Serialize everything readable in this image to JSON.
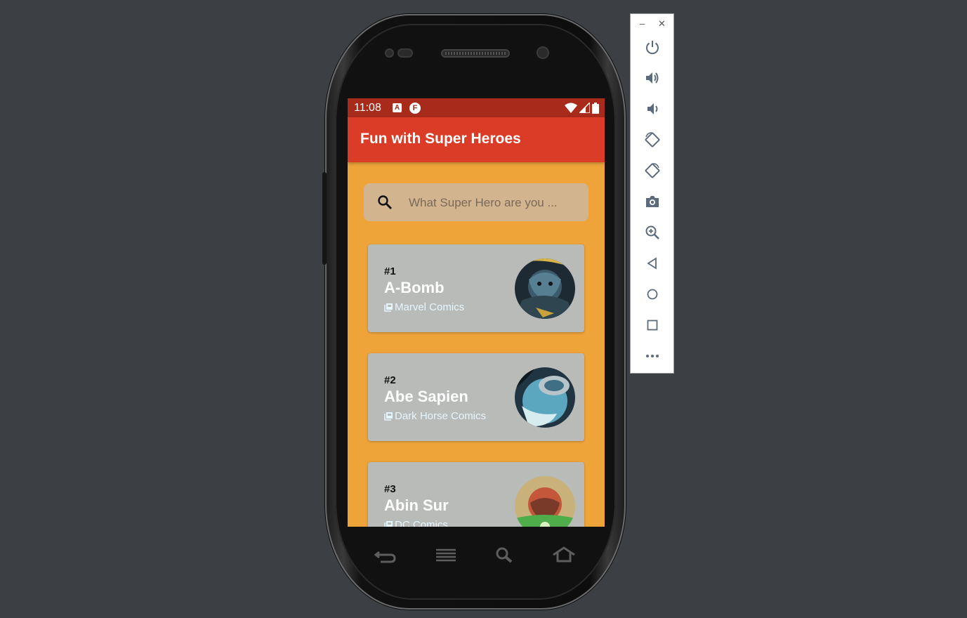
{
  "status_bar": {
    "time": "11:08",
    "icons": [
      "a-notification-icon",
      "f-notification-icon",
      "wifi-icon",
      "signal-icon",
      "battery-icon"
    ]
  },
  "app_bar": {
    "title": "Fun with Super Heroes"
  },
  "search": {
    "placeholder": "What Super Hero are you ...",
    "value": ""
  },
  "heroes": [
    {
      "rank": "#1",
      "name": "A-Bomb",
      "publisher": "Marvel Comics"
    },
    {
      "rank": "#2",
      "name": "Abe Sapien",
      "publisher": "Dark Horse Comics"
    },
    {
      "rank": "#3",
      "name": "Abin Sur",
      "publisher": "DC Comics"
    }
  ],
  "emulator_toolbar": {
    "window_controls": [
      "minimize-icon",
      "close-icon"
    ],
    "buttons": [
      "power-icon",
      "volume-up-icon",
      "volume-down-icon",
      "rotate-left-icon",
      "rotate-right-icon",
      "camera-icon",
      "zoom-icon",
      "back-icon",
      "home-icon",
      "overview-icon",
      "more-icon"
    ]
  },
  "colors": {
    "status_bar": "#a72a1b",
    "app_bar": "#db3c28",
    "background": "#efa43a",
    "card": "#b9bbb8",
    "search_field": "#d2b48f",
    "publisher_text": "#e6f6ff"
  }
}
